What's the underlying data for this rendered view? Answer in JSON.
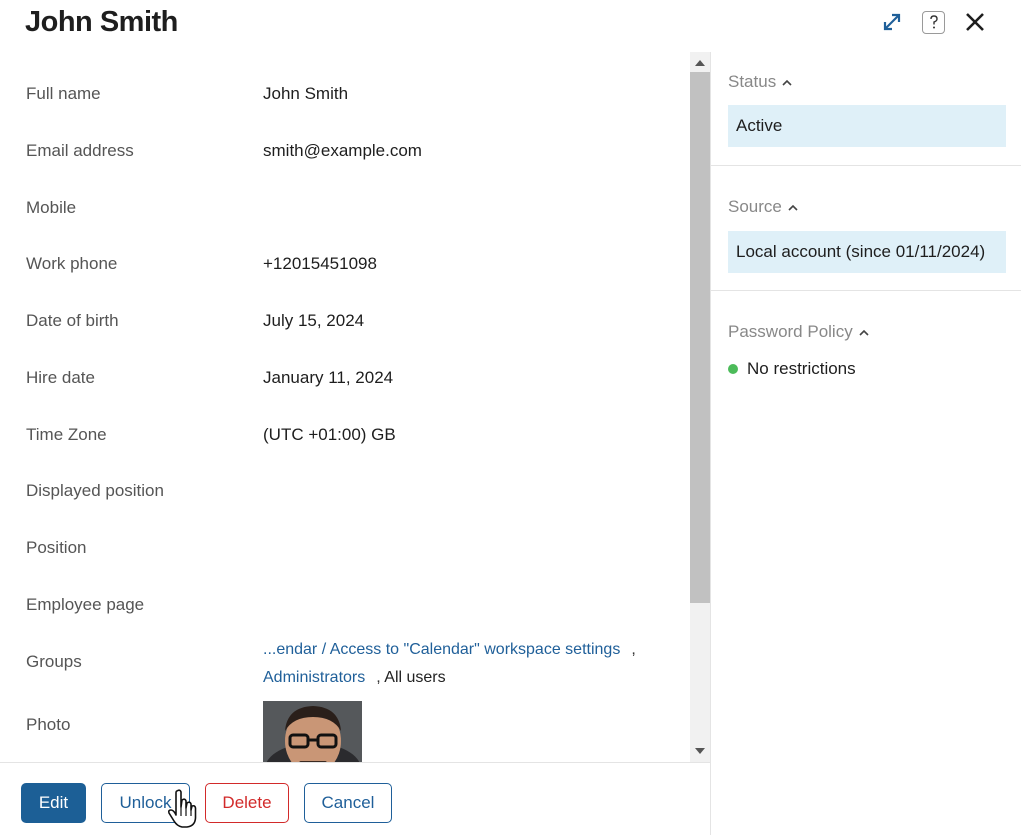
{
  "header": {
    "title": "John Smith"
  },
  "fields": {
    "full_name": {
      "label": "Full name",
      "value": "John Smith"
    },
    "email": {
      "label": "Email address",
      "value": "smith@example.com"
    },
    "mobile": {
      "label": "Mobile",
      "value": ""
    },
    "work_phone": {
      "label": "Work phone",
      "value": "+12015451098"
    },
    "date_of_birth": {
      "label": "Date of birth",
      "value": "July 15, 2024"
    },
    "hire_date": {
      "label": "Hire date",
      "value": "January 11, 2024"
    },
    "time_zone": {
      "label": "Time Zone",
      "value": "(UTC +01:00) GB"
    },
    "displayed_position": {
      "label": "Displayed position",
      "value": ""
    },
    "position": {
      "label": "Position",
      "value": ""
    },
    "employee_page": {
      "label": "Employee page",
      "value": ""
    },
    "groups": {
      "label": "Groups",
      "items": [
        "...endar / Access to \"Calendar\" workspace settings",
        "Administrators",
        "All users"
      ],
      "separator": ","
    },
    "photo": {
      "label": "Photo"
    }
  },
  "sidebar": {
    "status": {
      "title": "Status",
      "value": "Active"
    },
    "source": {
      "title": "Source",
      "value": "Local account (since 01/11/2024)"
    },
    "password_policy": {
      "title": "Password Policy",
      "value": "No restrictions",
      "indicator_color": "#4cbb5a"
    }
  },
  "footer": {
    "edit_label": "Edit",
    "unlock_label": "Unlock",
    "delete_label": "Delete",
    "cancel_label": "Cancel"
  },
  "icons": {
    "expand": "expand-icon",
    "help": "help-icon",
    "close": "close-icon",
    "caret": "chevron-up-icon"
  },
  "colors": {
    "primary": "#1c5f96",
    "link": "#1f5f99",
    "danger": "#d22a2a",
    "highlight": "#dff0f8",
    "status_dot": "#4cbb5a"
  }
}
